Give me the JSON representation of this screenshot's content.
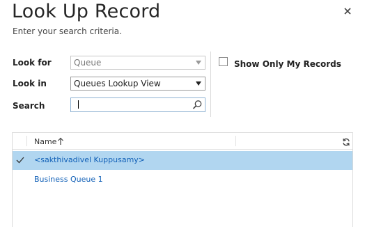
{
  "dialog": {
    "title": "Look Up Record",
    "subtitle": "Enter your search criteria."
  },
  "form": {
    "look_for_label": "Look for",
    "look_for_value": "Queue",
    "look_in_label": "Look in",
    "look_in_value": "Queues Lookup View",
    "search_label": "Search",
    "search_value": "",
    "show_only_mine_label": "Show Only My Records",
    "show_only_mine_checked": false
  },
  "grid": {
    "columns": [
      {
        "label": "Name",
        "sort": "ascending"
      }
    ],
    "rows": [
      {
        "name": "<sakthivadivel Kuppusamy>",
        "selected": true
      },
      {
        "name": "Business Queue 1",
        "selected": false
      }
    ]
  },
  "icons": {
    "close": "close-icon",
    "search": "search-icon",
    "sort": "sort-ascending-icon",
    "refresh": "refresh-icon",
    "selected": "checkmark-icon"
  },
  "colors": {
    "selected_row": "#b1d6f0",
    "link_text": "#1160b7",
    "search_border": "#8fb2d3"
  }
}
